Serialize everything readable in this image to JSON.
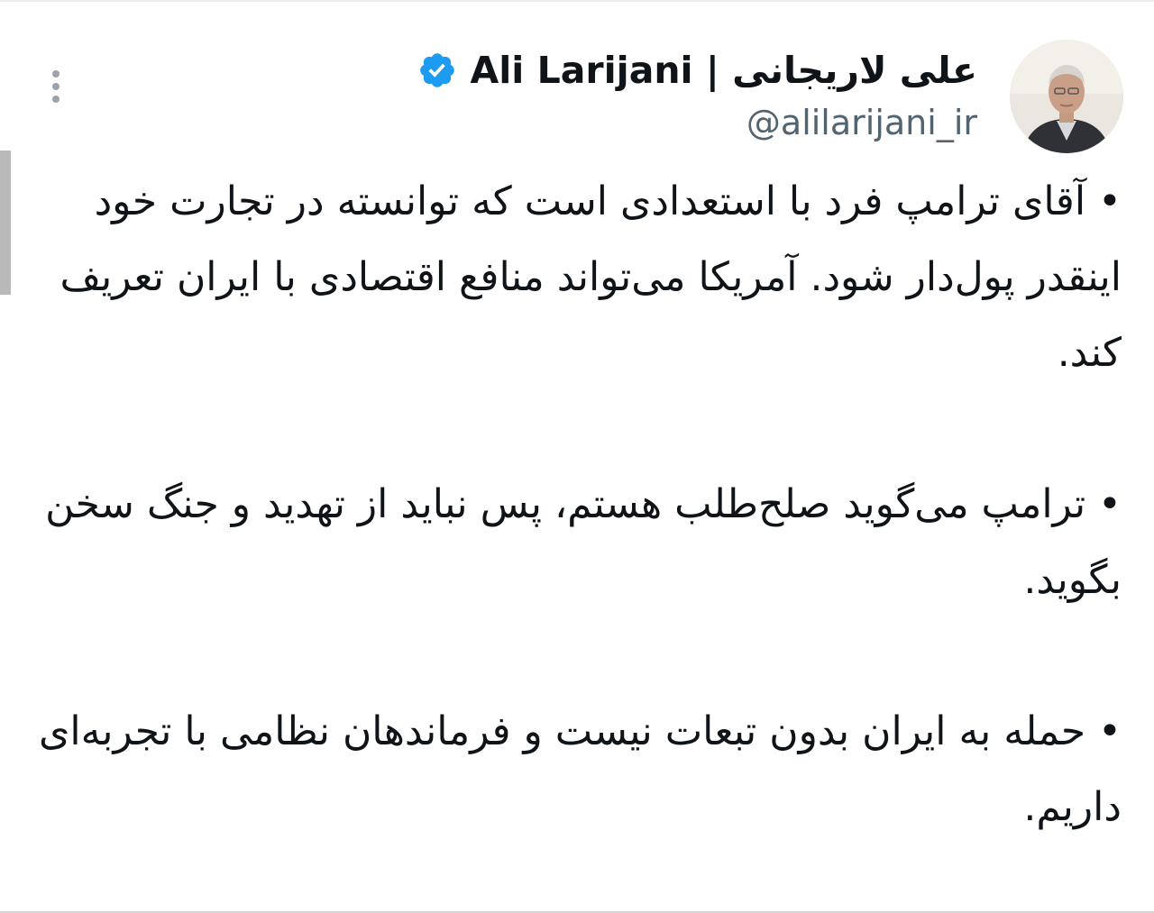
{
  "tweet": {
    "display_name": "Ali Larijani | علی لاریجانی",
    "handle": "@alilarijani_ir",
    "verified": true,
    "paragraphs": [
      "• آقای ترامپ فرد با استعدادی است که توانسته در تجارت خود اینقدر پول‌دار شود. آمریکا می‌تواند منافع اقتصادی با ایران تعریف کند.",
      "• ترامپ می‌گوید صلح‌طلب هستم، پس نباید از تهدید و جنگ سخن بگوید.",
      "• حمله به ایران بدون تبعات نیست و فرماندهان نظامی با تجربه‌ای داریم."
    ]
  },
  "icons": {
    "verified": "verified-badge-icon",
    "more": "more-vertical-icon"
  },
  "colors": {
    "verified_badge": "#1d9bf0",
    "text_primary": "#0f1419",
    "text_secondary": "#536471",
    "more_dots": "#9aa3ab"
  }
}
